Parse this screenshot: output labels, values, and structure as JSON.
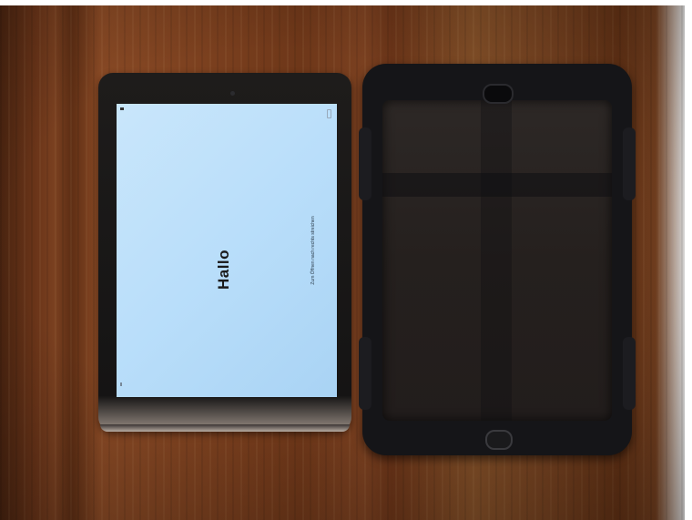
{
  "screen": {
    "greeting": "Hallo",
    "hint": "Zum Öffnen nach rechts streichen"
  },
  "colors": {
    "screen": "#bfe2fb",
    "wood": "#7a4020",
    "case": "#151518"
  }
}
